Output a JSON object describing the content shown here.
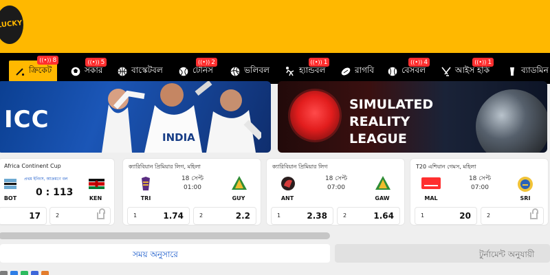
{
  "header": {
    "brand": "LUCKY"
  },
  "nav": {
    "items": [
      {
        "label": "ক্রিকেট",
        "badge": "8",
        "active": true
      },
      {
        "label": "সকার",
        "badge": "5",
        "active": false
      },
      {
        "label": "বাস্কেটবল",
        "badge": "",
        "active": false
      },
      {
        "label": "টেনিস",
        "badge": "2",
        "active": false
      },
      {
        "label": "ভলিবল",
        "badge": "",
        "active": false
      },
      {
        "label": "হ্যান্ডবল",
        "badge": "1",
        "active": false
      },
      {
        "label": "রাগবি",
        "badge": "",
        "active": false
      },
      {
        "label": "বেসবল",
        "badge": "4",
        "active": false
      },
      {
        "label": "আইস হকি",
        "badge": "1",
        "active": false
      },
      {
        "label": "ব্যাডমিন",
        "badge": "",
        "active": false
      }
    ],
    "icons": [
      "cricket-icon",
      "soccer-icon",
      "basketball-icon",
      "tennis-icon",
      "volleyball-icon",
      "handball-icon",
      "rugby-icon",
      "baseball-icon",
      "ice-hockey-icon",
      "badminton-icon"
    ]
  },
  "banners": {
    "left": {
      "logo": "ICC"
    },
    "right": {
      "title_lines": [
        "SIMULATED",
        "REALITY",
        "LEAGUE"
      ]
    }
  },
  "matches": [
    {
      "league": "Africa Continent Cup",
      "status": "প্রথম ইনিংস, আক্রমণে বল",
      "team_a": "BOT",
      "team_b": "KEN",
      "score": "0 : 113",
      "odds": [
        "17",
        "2"
      ],
      "locked": true
    },
    {
      "league": "ক্যারিবিয়ান প্রিমিয়ার লিগ, মহিলা",
      "date": "18 সেপ্ট",
      "time": "01:00",
      "team_a": "TRI",
      "team_b": "GUY",
      "odds_labels": [
        "1",
        "2"
      ],
      "odds": [
        "1.74",
        "2.2"
      ]
    },
    {
      "league": "ক্যারিবিয়ান প্রিমিয়ার লিগ",
      "date": "18 সেপ্ট",
      "time": "07:00",
      "team_a": "ANT",
      "team_b": "GAW",
      "odds_labels": [
        "1",
        "2"
      ],
      "odds": [
        "2.38",
        "1.64"
      ]
    },
    {
      "league": "T20 এশিয়ান গেমস, মহিলা",
      "date": "18 সেপ্ট",
      "time": "07:00",
      "team_a": "MAL",
      "team_b": "SRI",
      "odds_labels": [
        "1",
        "2"
      ],
      "odds": [
        "20",
        "2"
      ],
      "locked": true
    }
  ],
  "tabs": {
    "left": "সময় অনুসারে",
    "right": "টুর্নামেন্ট অনুযায়ী"
  },
  "colors": {
    "header": "#ffb800",
    "nav": "#000000",
    "active": "#ffb800",
    "badge": "#ff2f2f",
    "link": "#1456c9"
  }
}
